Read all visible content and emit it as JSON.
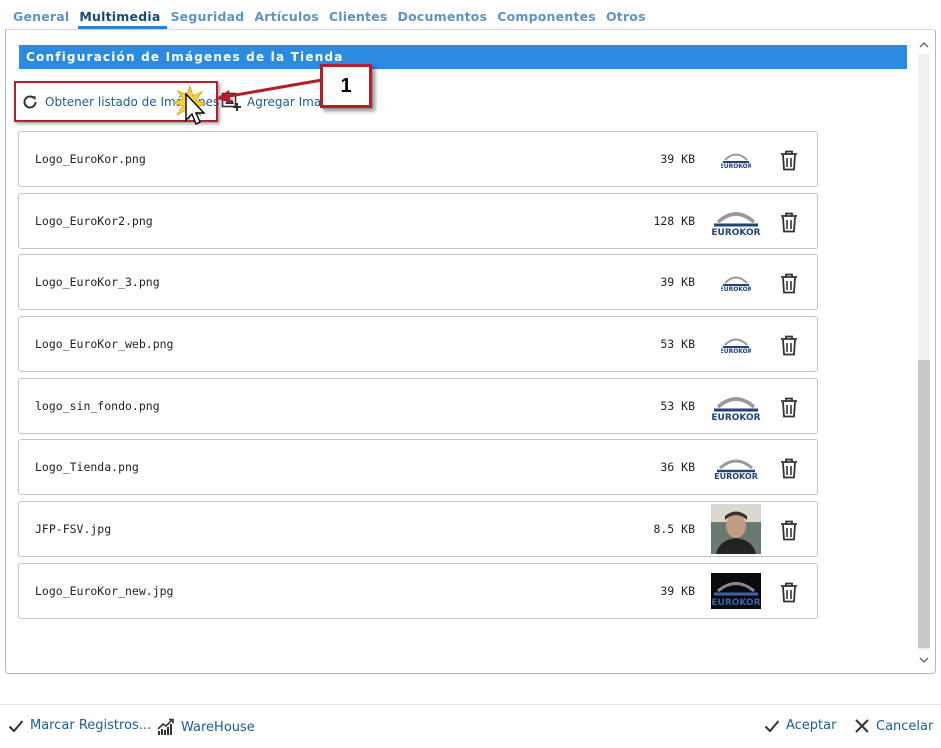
{
  "tabs": [
    {
      "label": "General",
      "active": false
    },
    {
      "label": "Multimedia",
      "active": true
    },
    {
      "label": "Seguridad",
      "active": false
    },
    {
      "label": "Artículos",
      "active": false
    },
    {
      "label": "Clientes",
      "active": false
    },
    {
      "label": "Documentos",
      "active": false
    },
    {
      "label": "Componentes",
      "active": false
    },
    {
      "label": "Otros",
      "active": false
    }
  ],
  "section": {
    "title": "Configuración de Imágenes de la Tienda"
  },
  "toolbar": {
    "refresh_label": "Obtener listado de Imágenes",
    "add_label": "Agregar Imagen"
  },
  "annotation": {
    "callout_number": "1"
  },
  "images": [
    {
      "name": "Logo_EuroKor.png",
      "size": "39 KB",
      "thumb": "logo-small"
    },
    {
      "name": "Logo_EuroKor2.png",
      "size": "128 KB",
      "thumb": "logo-large"
    },
    {
      "name": "Logo_EuroKor_3.png",
      "size": "39 KB",
      "thumb": "logo-small"
    },
    {
      "name": "Logo_EuroKor_web.png",
      "size": "53 KB",
      "thumb": "logo-small"
    },
    {
      "name": "logo_sin_fondo.png",
      "size": "53 KB",
      "thumb": "logo-large"
    },
    {
      "name": "Logo_Tienda.png",
      "size": "36 KB",
      "thumb": "logo-medium"
    },
    {
      "name": "JFP-FSV.jpg",
      "size": "8.5 KB",
      "thumb": "photo"
    },
    {
      "name": "Logo_EuroKor_new.jpg",
      "size": "39 KB",
      "thumb": "logo-dark"
    }
  ],
  "footer": {
    "mark_label": "Marcar Registros...",
    "warehouse_label": "WareHouse",
    "accept_label": "Aceptar",
    "cancel_label": "Cancelar"
  },
  "colors": {
    "accent": "#2b8be0",
    "link": "#1b5d95",
    "tab_inactive": "#5f93c6",
    "callout_border": "#b0202a"
  }
}
